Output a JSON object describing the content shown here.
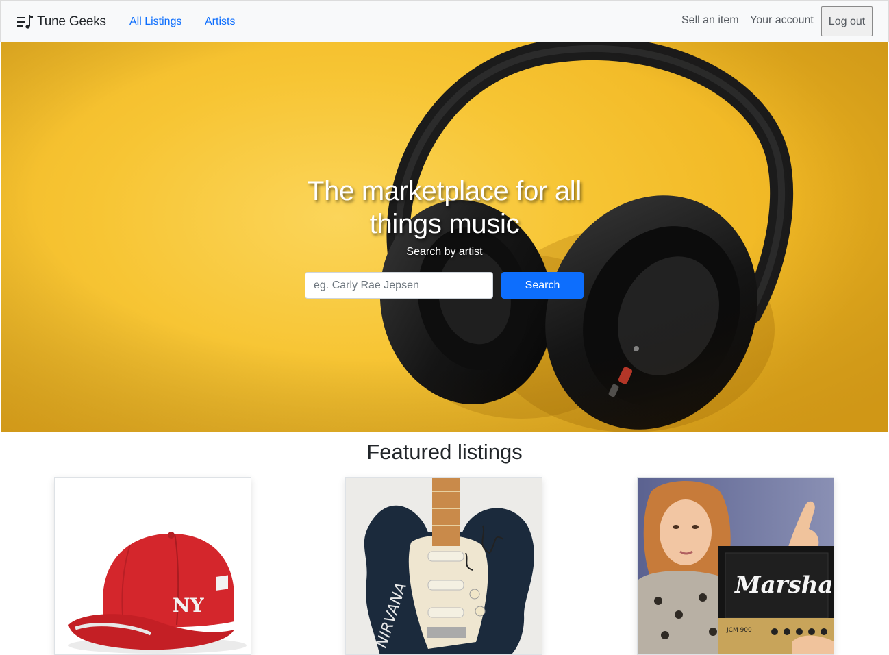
{
  "navbar": {
    "brand": "Tune Geeks",
    "links": [
      {
        "label": "All Listings"
      },
      {
        "label": "Artists"
      }
    ],
    "right": {
      "sell": "Sell an item",
      "account": "Your account",
      "logout": "Log out"
    }
  },
  "hero": {
    "title": "The marketplace for all things music",
    "subtitle": "Search by artist",
    "search": {
      "placeholder": "eg. Carly Rae Jepsen",
      "button": "Search"
    }
  },
  "featured": {
    "title": "Featured listings",
    "cards": [
      {
        "image": "red-baseball-cap-ny-image"
      },
      {
        "image": "signed-nirvana-guitar-image"
      },
      {
        "image": "marshall-amp-image"
      }
    ]
  },
  "images": {
    "marshall_logo_text": "Marshall",
    "jcm_text": "JCM 900",
    "guitar_text": "NIRVANA",
    "cap_logo": "NY"
  },
  "colors": {
    "primary": "#0d6efd",
    "hero_yellow": "#f7c534",
    "navbar_bg": "#f8f9fa"
  }
}
